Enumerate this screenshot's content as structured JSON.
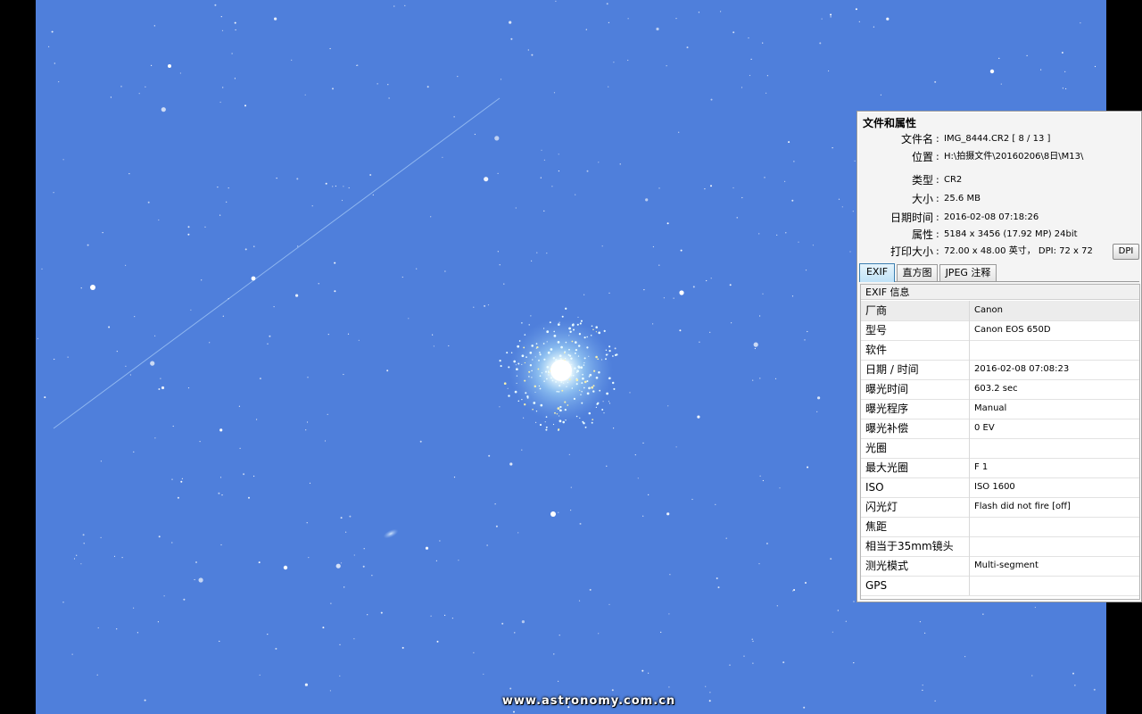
{
  "watermark": "www.astronomy.com.cn",
  "panel": {
    "title": "文件和属性",
    "properties": [
      {
        "label": "文件名",
        "value": "IMG_8444.CR2   [ 8 / 13 ]"
      },
      {
        "label": "位置",
        "value": "H:\\拍摄文件\\20160206\\8日\\M13\\"
      },
      {
        "label": "类型",
        "value": "CR2"
      },
      {
        "label": "大小",
        "value": "25.6 MB"
      },
      {
        "label": "日期时间",
        "value": "2016-02-08 07:18:26"
      },
      {
        "label": "属性",
        "value": "5184 x 3456 (17.92 MP)  24bit"
      },
      {
        "label": "打印大小",
        "value": "72.00 x 48.00 英寸，  DPI: 72 x 72"
      }
    ],
    "dpi_button": "DPI",
    "tabs": [
      "EXIF",
      "直方图",
      "JPEG 注释"
    ],
    "active_tab": "EXIF",
    "exif_header": "EXIF 信息",
    "exif_rows": [
      {
        "key": "厂商",
        "value": "Canon"
      },
      {
        "key": "型号",
        "value": "Canon EOS 650D"
      },
      {
        "key": "软件",
        "value": ""
      },
      {
        "key": "日期 / 时间",
        "value": "2016-02-08 07:08:23"
      },
      {
        "key": "曝光时间",
        "value": "603.2 sec"
      },
      {
        "key": "曝光程序",
        "value": "Manual"
      },
      {
        "key": "曝光补偿",
        "value": "0 EV"
      },
      {
        "key": "光圈",
        "value": ""
      },
      {
        "key": "最大光圈",
        "value": "F 1"
      },
      {
        "key": "ISO",
        "value": "ISO 1600"
      },
      {
        "key": "闪光灯",
        "value": "Flash did not fire [off]"
      },
      {
        "key": "焦距",
        "value": ""
      },
      {
        "key": "相当于35mm镜头",
        "value": ""
      },
      {
        "key": "测光模式",
        "value": "Multi-segment"
      },
      {
        "key": "GPS",
        "value": ""
      }
    ]
  },
  "colors": {
    "sky": "#4f7fdb",
    "star": "#ffffff",
    "cluster_core": "#e8ffff",
    "active_tab": "#bfe2f7"
  }
}
